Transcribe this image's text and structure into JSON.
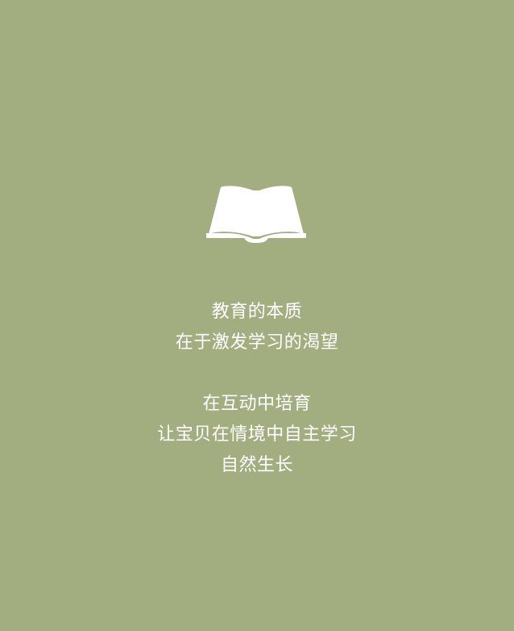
{
  "colors": {
    "background": "#a3ae80",
    "text": "#ffffff",
    "icon": "#ffffff"
  },
  "icon": {
    "name": "open-book-icon"
  },
  "text": {
    "group1": {
      "line1": "教育的本质",
      "line2": "在于激发学习的渴望"
    },
    "group2": {
      "line1": "在互动中培育",
      "line2": "让宝贝在情境中自主学习",
      "line3": "自然生长"
    }
  }
}
